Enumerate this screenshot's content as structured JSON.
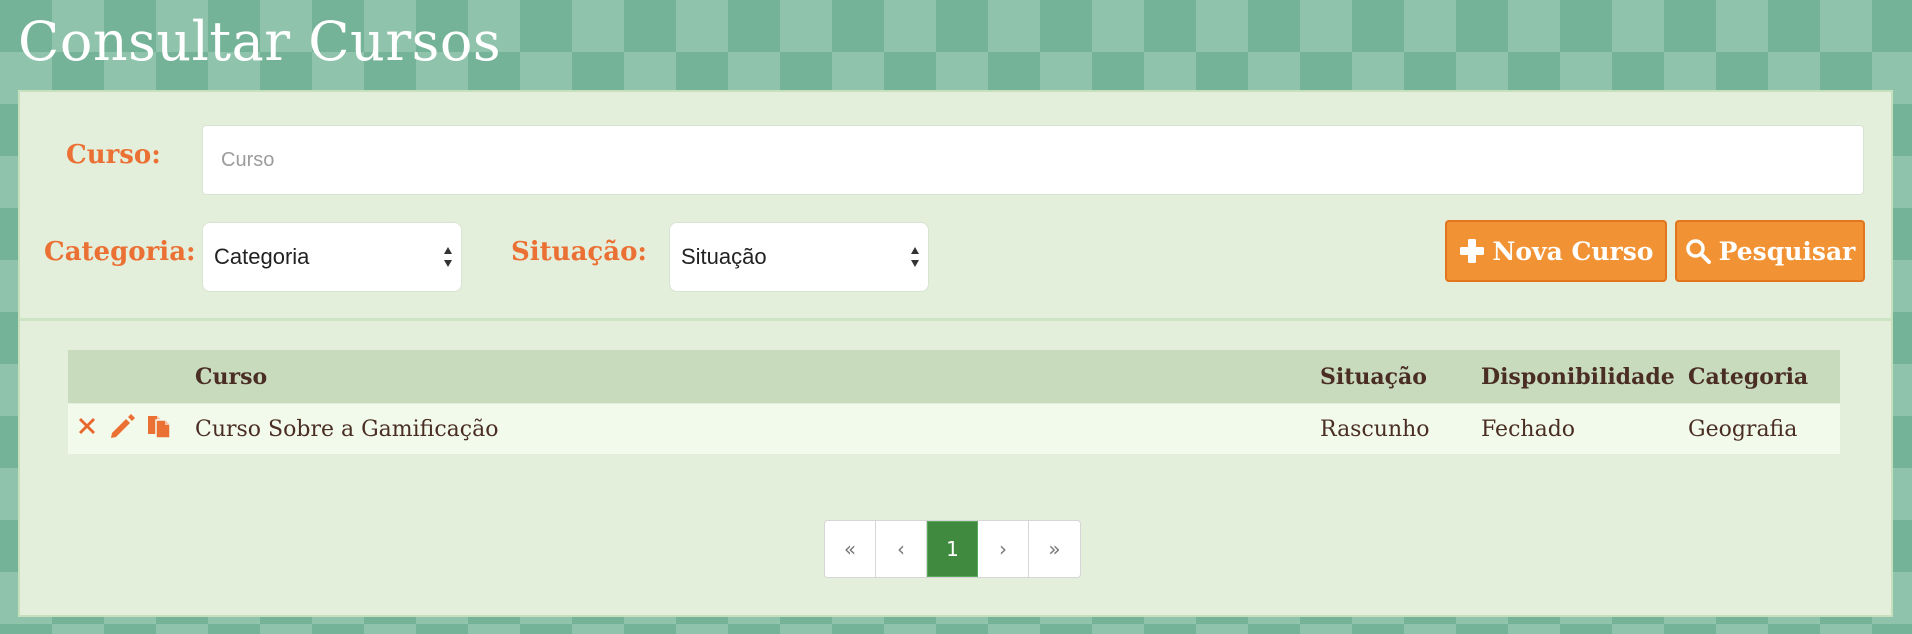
{
  "page": {
    "title": "Consultar Cursos"
  },
  "filters": {
    "course_label": "Curso:",
    "course_placeholder": "Curso",
    "course_value": "",
    "category_label": "Categoria:",
    "category_selected": "Categoria",
    "status_label": "Situação:",
    "status_selected": "Situação"
  },
  "buttons": {
    "new_course": "Nova Curso",
    "search": "Pesquisar"
  },
  "table": {
    "headers": [
      "",
      "Curso",
      "Situação",
      "Disponibilidade",
      "Categoria"
    ],
    "rows": [
      {
        "actions": [
          "delete-icon",
          "edit-icon",
          "copy-icon"
        ],
        "course": "Curso Sobre a Gamificação",
        "status": "Rascunho",
        "availability": "Fechado",
        "category": "Geografia"
      }
    ]
  },
  "pagination": {
    "first": "«",
    "prev": "‹",
    "current": "1",
    "next": "›",
    "last": "»"
  },
  "colors": {
    "accent_orange": "#eb7033",
    "button_orange": "#f19334",
    "background_green": "#74b398",
    "panel": "#e3eedb",
    "active_page": "#3f8a3f",
    "text_brown": "#4a2e24"
  }
}
